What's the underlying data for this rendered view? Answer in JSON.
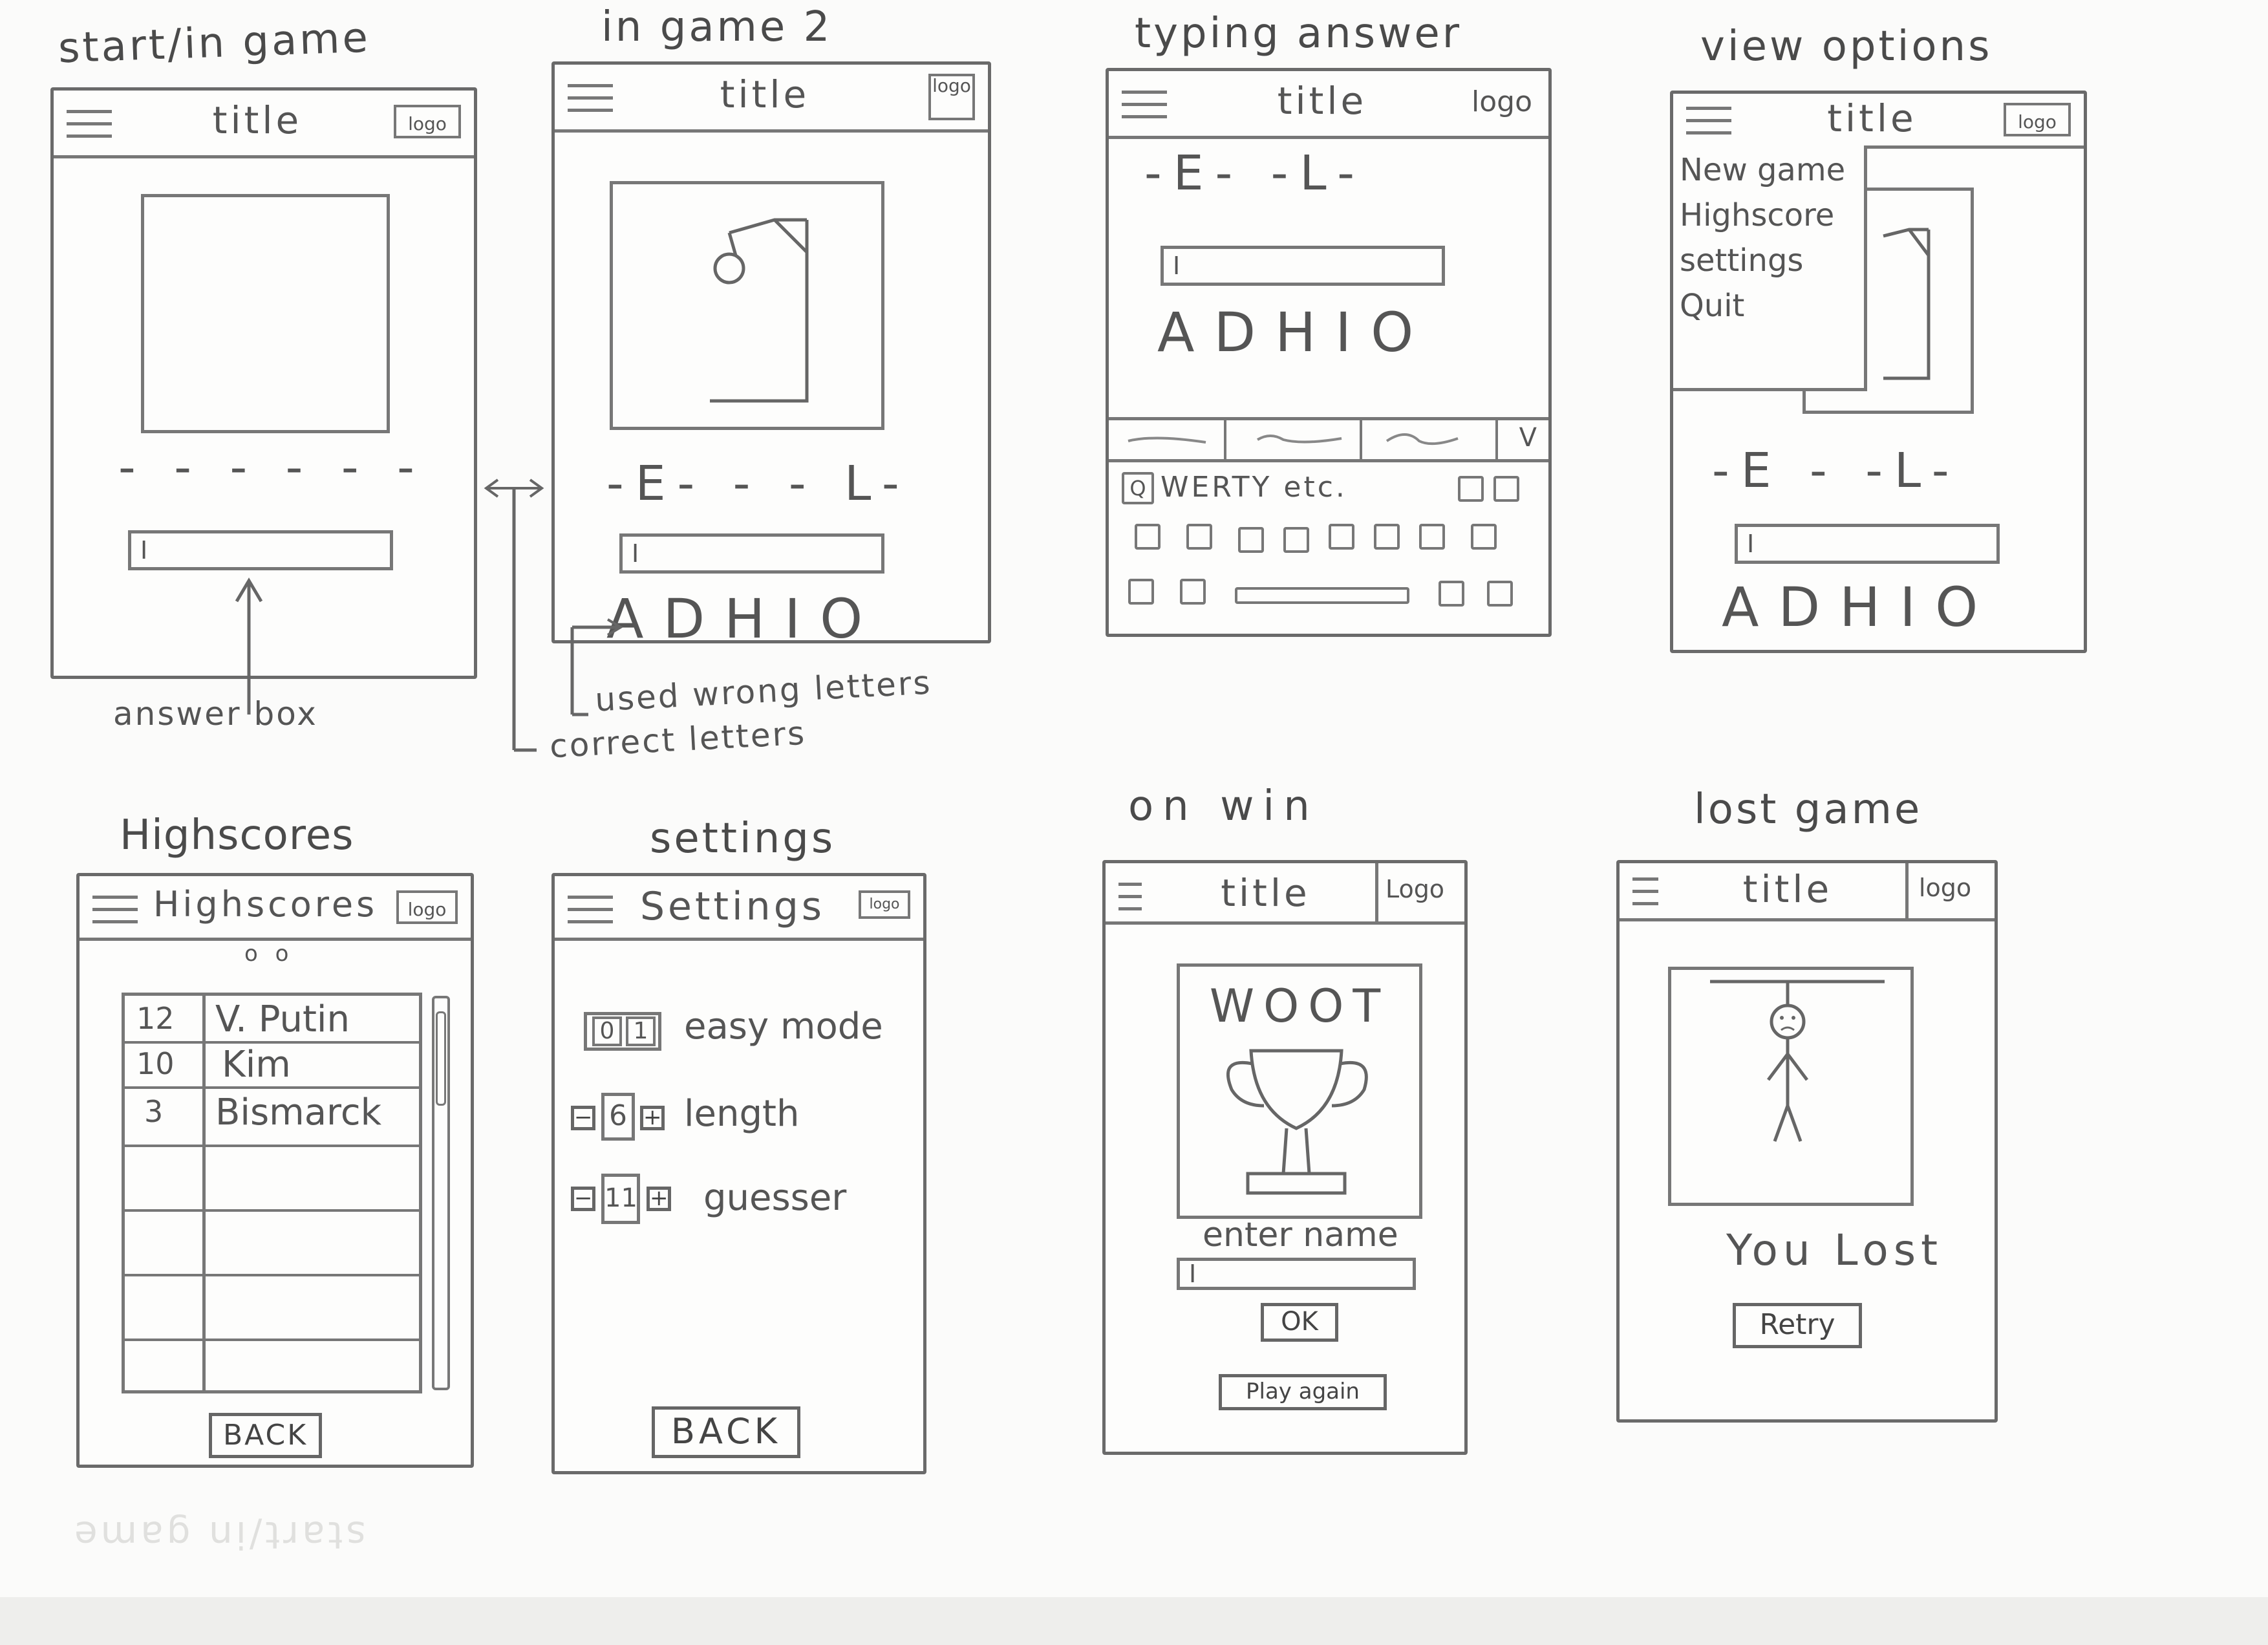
{
  "screens": {
    "start": {
      "label": "start/in game",
      "title": "title",
      "logo": "logo",
      "dashes": "- - - - - -",
      "answer_cursor": "I",
      "callout": "answer box"
    },
    "ingame2": {
      "label": "in game 2",
      "title": "title",
      "logo": "logo",
      "dashes": "-E- - - L-",
      "answer_cursor": "I",
      "wrong_letters": "ADHIO",
      "callout_wrong": "used wrong letters",
      "callout_correct": "correct letters"
    },
    "typing": {
      "label": "typing answer",
      "title": "title",
      "logo": "logo",
      "dashes": "-E- -L-",
      "answer_cursor": "I",
      "wrong_letters": "ADHIO",
      "keyboard_first_key": "Q",
      "keyboard_text": "WERTY etc.",
      "kb_tab_right": "V"
    },
    "options": {
      "label": "view options",
      "title": "title",
      "logo": "logo",
      "menu": [
        "New game",
        "Highscore",
        "settings",
        "Quit"
      ],
      "dashes": "-E - -L-",
      "answer_cursor": "I",
      "wrong_letters": "ADHIO"
    },
    "highscores": {
      "label": "Highscores",
      "title": "Highscores",
      "logo": "logo",
      "dots": "o o",
      "rows": [
        {
          "score": "12",
          "name": "V. Putin"
        },
        {
          "score": "10",
          "name": "Kim"
        },
        {
          "score": "3",
          "name": "Bismarck"
        }
      ],
      "back": "BACK"
    },
    "settings": {
      "label": "settings",
      "title": "Settings",
      "logo": "logo",
      "toggle_off": "0",
      "toggle_on": "1",
      "easy_label": "easy mode",
      "length_value": "6",
      "length_label": "length",
      "guesses_value": "11",
      "guesses_label": "guesser",
      "back": "BACK"
    },
    "win": {
      "label": "on win",
      "title": "title",
      "logo": "Logo",
      "woot": "WOOT",
      "enter_name": "enter name",
      "answer_cursor": "I",
      "ok": "OK",
      "play_again": "Play again"
    },
    "lost": {
      "label": "lost game",
      "title": "title",
      "logo": "logo",
      "message": "You Lost",
      "retry": "Retry"
    }
  },
  "mirror_text": "start/in game"
}
